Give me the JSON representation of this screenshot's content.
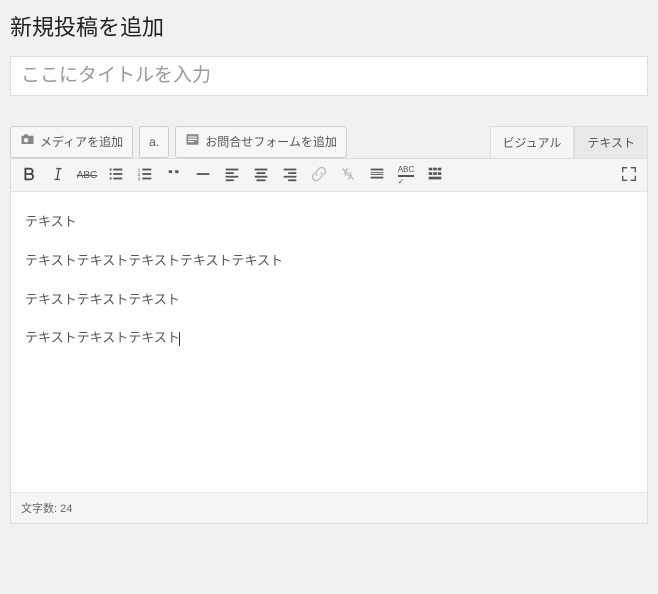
{
  "page_title": "新規投稿を追加",
  "title_input": {
    "value": "",
    "placeholder": "ここにタイトルを入力"
  },
  "buttons": {
    "media": "メディアを追加",
    "amazon": "a.",
    "contact_form": "お問合せフォームを追加"
  },
  "tabs": {
    "visual": "ビジュアル",
    "text": "テキスト",
    "active": "visual"
  },
  "content_lines": [
    "テキスト",
    "テキストテキストテキストテキストテキスト",
    "テキストテキストテキスト",
    "テキストテキストテキスト"
  ],
  "statusbar": {
    "label": "文字数:",
    "count": "24"
  }
}
